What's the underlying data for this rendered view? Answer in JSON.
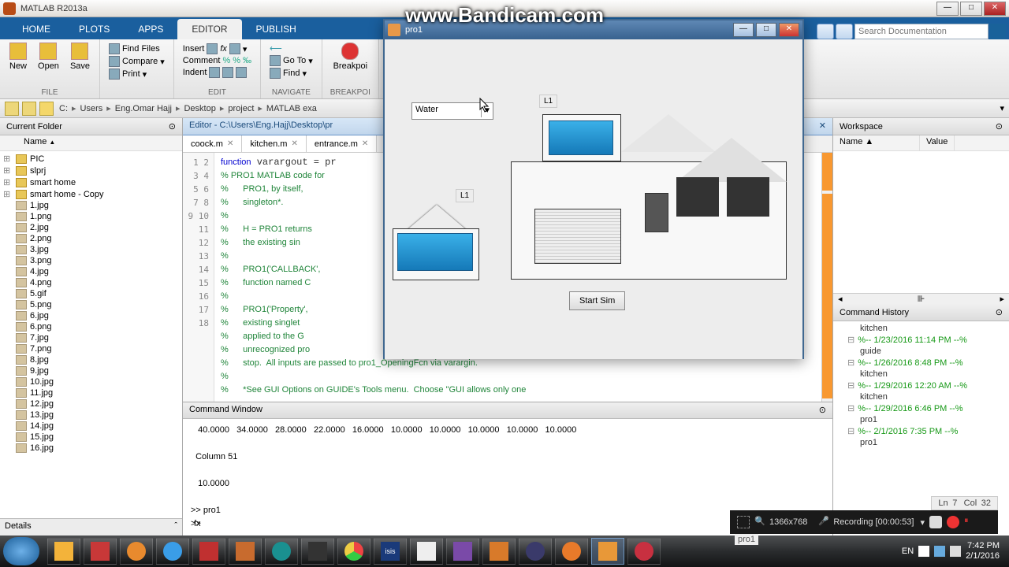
{
  "watermark": "www.Bandicam.com",
  "app_title": "MATLAB R2013a",
  "tabs": [
    "HOME",
    "PLOTS",
    "APPS",
    "EDITOR",
    "PUBLISH"
  ],
  "active_tab": 3,
  "search_placeholder": "Search Documentation",
  "ribbon": {
    "groups": [
      "FILE",
      "EDIT",
      "NAVIGATE",
      "BREAKPOI"
    ],
    "file_btns": [
      {
        "l": "New"
      },
      {
        "l": "Open"
      },
      {
        "l": "Save"
      }
    ],
    "file_small": [
      "Find Files",
      "Compare",
      "Print"
    ],
    "edit_hdr": [
      "Insert",
      "Comment",
      "Indent"
    ],
    "nav": [
      "Go To",
      "Find"
    ],
    "breakp": "Breakpoi"
  },
  "path_parts": [
    "C:",
    "Users",
    "Eng.Omar Hajj",
    "Desktop",
    "project",
    "MATLAB exa"
  ],
  "current_folder": {
    "title": "Current Folder",
    "col": "Name",
    "folders": [
      "PIC",
      "slprj",
      "smart home",
      "smart home - Copy"
    ],
    "files": [
      "1.jpg",
      "1.png",
      "2.jpg",
      "2.png",
      "3.jpg",
      "3.png",
      "4.jpg",
      "4.png",
      "5.gif",
      "5.png",
      "6.jpg",
      "6.png",
      "7.jpg",
      "7.png",
      "8.jpg",
      "9.jpg",
      "10.jpg",
      "11.jpg",
      "12.jpg",
      "13.jpg",
      "14.jpg",
      "15.jpg",
      "16.jpg"
    ],
    "details": "Details"
  },
  "editor": {
    "header": "Editor - C:\\Users\\Eng.Hajj\\Desktop\\pr",
    "tabs": [
      "coock.m",
      "kitchen.m",
      "entrance.m"
    ],
    "lines_count": 18,
    "code": "function varargout = pr\n% PRO1 MATLAB code for\n%      PRO1, by itself,\n%      singleton*.\n%\n%      H = PRO1 returns\n%      the existing sin\n%\n%      PRO1('CALLBACK',\n%      function named C\n%\n%      PRO1('Property',\n%      existing singlet\n%      applied to the G\n%      unrecognized pro\n%      stop.  All inputs are passed to pro1_OpeningFcn via varargin.\n%\n%      *See GUI Options on GUIDE's Tools menu.  Choose \"GUI allows only one"
  },
  "cmdwin": {
    "title": "Command Window",
    "text": "   40.0000   34.0000   28.0000   22.0000   16.0000   10.0000   10.0000   10.0000   10.0000   10.0000\n\n  Column 51\n\n   10.0000\n\n>> pro1\n>> "
  },
  "workspace": {
    "title": "Workspace",
    "cols": [
      "Name",
      "Value"
    ]
  },
  "cmdhist": {
    "title": "Command History",
    "items": [
      {
        "t": "kitchen",
        "d": false,
        "i": 1
      },
      {
        "t": "%-- 1/23/2016 11:14 PM --%",
        "d": true,
        "i": 0
      },
      {
        "t": "guide",
        "d": false,
        "i": 1
      },
      {
        "t": "%-- 1/26/2016  8:48 PM --%",
        "d": true,
        "i": 0
      },
      {
        "t": "kitchen",
        "d": false,
        "i": 1
      },
      {
        "t": "%-- 1/29/2016 12:20 AM --%",
        "d": true,
        "i": 0
      },
      {
        "t": "kitchen",
        "d": false,
        "i": 1
      },
      {
        "t": "%-- 1/29/2016  6:46 PM --%",
        "d": true,
        "i": 0
      },
      {
        "t": "pro1",
        "d": false,
        "i": 1
      },
      {
        "t": "%-- 2/1/2016  7:35 PM --%",
        "d": true,
        "i": 0
      },
      {
        "t": "pro1",
        "d": false,
        "i": 1
      }
    ]
  },
  "figure": {
    "title": "pro1",
    "dropdown": "Water",
    "label1": "L1",
    "label2": "L1",
    "simbtn": "Start Sim"
  },
  "rec": {
    "res": "1366x768",
    "status": "Recording [00:00:53]",
    "name": "pro1"
  },
  "cursor_stat": {
    "ln": "Ln",
    "lv": "7",
    "col": "Col",
    "cv": "32"
  },
  "tray": {
    "lang": "EN",
    "time": "7:42 PM",
    "date": "2/1/2016"
  }
}
